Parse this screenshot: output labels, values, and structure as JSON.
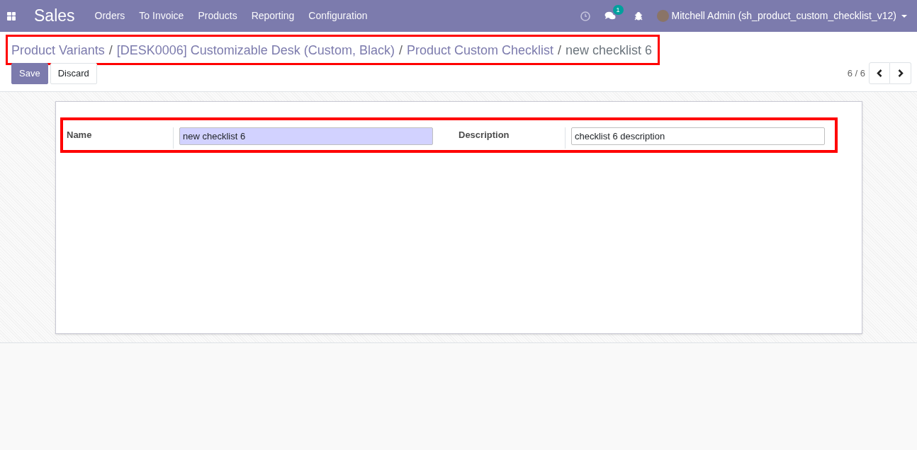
{
  "navbar": {
    "app_title": "Sales",
    "menu": [
      "Orders",
      "To Invoice",
      "Products",
      "Reporting",
      "Configuration"
    ],
    "messages_badge": "1",
    "user": "Mitchell Admin (sh_product_custom_checklist_v12)"
  },
  "breadcrumbs": [
    {
      "label": "Product Variants",
      "link": true
    },
    {
      "separator": "/",
      "label": "[DESK0006] Customizable Desk (Custom, Black)",
      "link": true
    },
    {
      "separator": "/",
      "label": "Product Custom Checklist",
      "link": true
    },
    {
      "separator": "/",
      "label": "new checklist 6",
      "link": false
    }
  ],
  "buttons": [
    {
      "label": "Save",
      "kind": "primary"
    },
    {
      "label": "Discard",
      "kind": "secondary"
    }
  ],
  "pager": "6 / 6",
  "fields": [
    {
      "label": "Name",
      "value": "new checklist 6",
      "required": true
    },
    {
      "label": "Description",
      "value": "checklist 6 description",
      "required": false
    }
  ]
}
